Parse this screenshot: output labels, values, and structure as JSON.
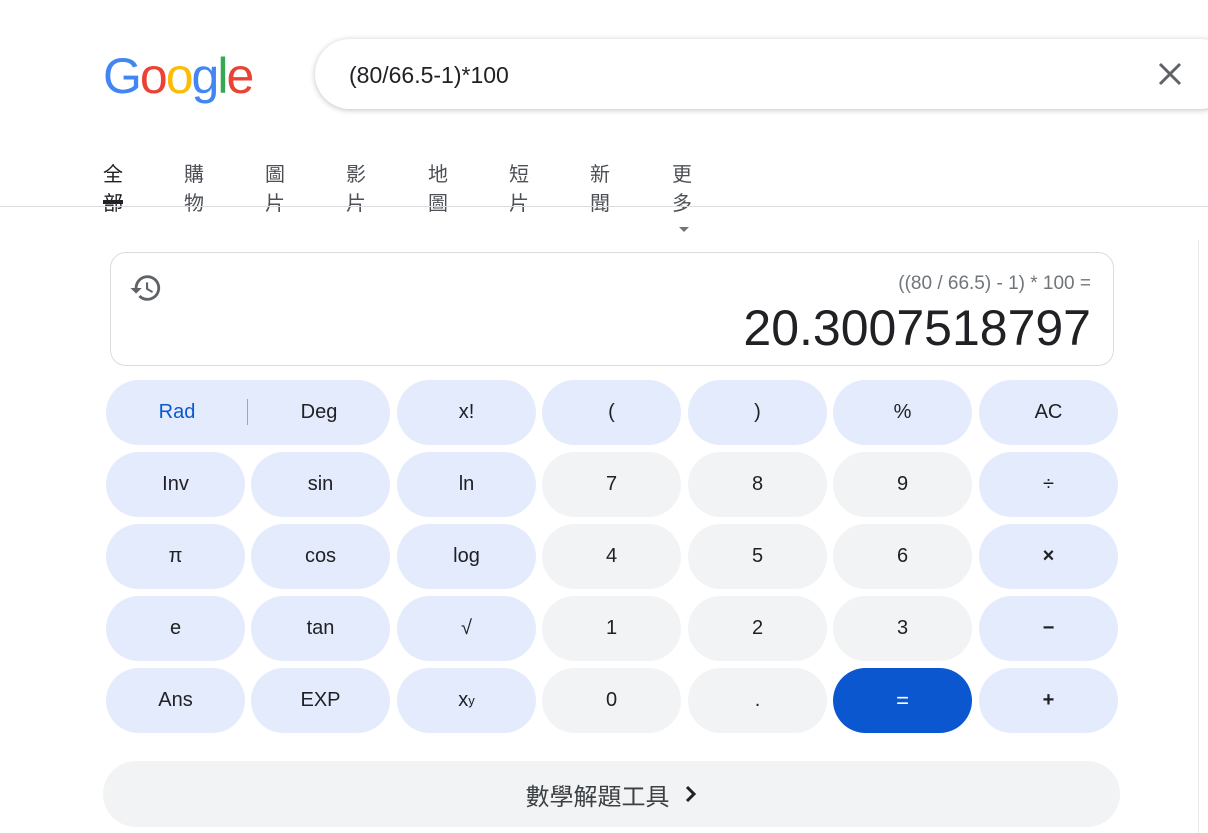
{
  "logo": {
    "letters": [
      "G",
      "o",
      "o",
      "g",
      "l",
      "e"
    ],
    "colors": [
      "#4285F4",
      "#EA4335",
      "#FBBC05",
      "#4285F4",
      "#34A853",
      "#EA4335"
    ]
  },
  "search": {
    "query": "(80/66.5-1)*100"
  },
  "tabs": [
    {
      "label": "全部",
      "active": true
    },
    {
      "label": "購物"
    },
    {
      "label": "圖片"
    },
    {
      "label": "影片"
    },
    {
      "label": "地圖"
    },
    {
      "label": "短片"
    },
    {
      "label": "新聞"
    },
    {
      "label": "更多"
    }
  ],
  "calculator": {
    "expression": "((80 / 66.5) - 1) * 100 =",
    "result": "20.3007518797",
    "rad": "Rad",
    "deg": "Deg",
    "keys": {
      "fact": "x!",
      "lparen": "(",
      "rparen": ")",
      "percent": "%",
      "ac": "AC",
      "inv": "Inv",
      "sin": "sin",
      "ln": "ln",
      "n7": "7",
      "n8": "8",
      "n9": "9",
      "div": "÷",
      "pi": "π",
      "cos": "cos",
      "log": "log",
      "n4": "4",
      "n5": "5",
      "n6": "6",
      "mul": "×",
      "e": "e",
      "tan": "tan",
      "sqrt": "√",
      "n1": "1",
      "n2": "2",
      "n3": "3",
      "sub": "−",
      "ans": "Ans",
      "exp": "EXP",
      "pow_base": "x",
      "pow_exp": "y",
      "n0": "0",
      "dot": ".",
      "eq": "=",
      "add": "+"
    },
    "accent_color": "#0b57d0"
  },
  "solver": {
    "label": "數學解題工具"
  }
}
